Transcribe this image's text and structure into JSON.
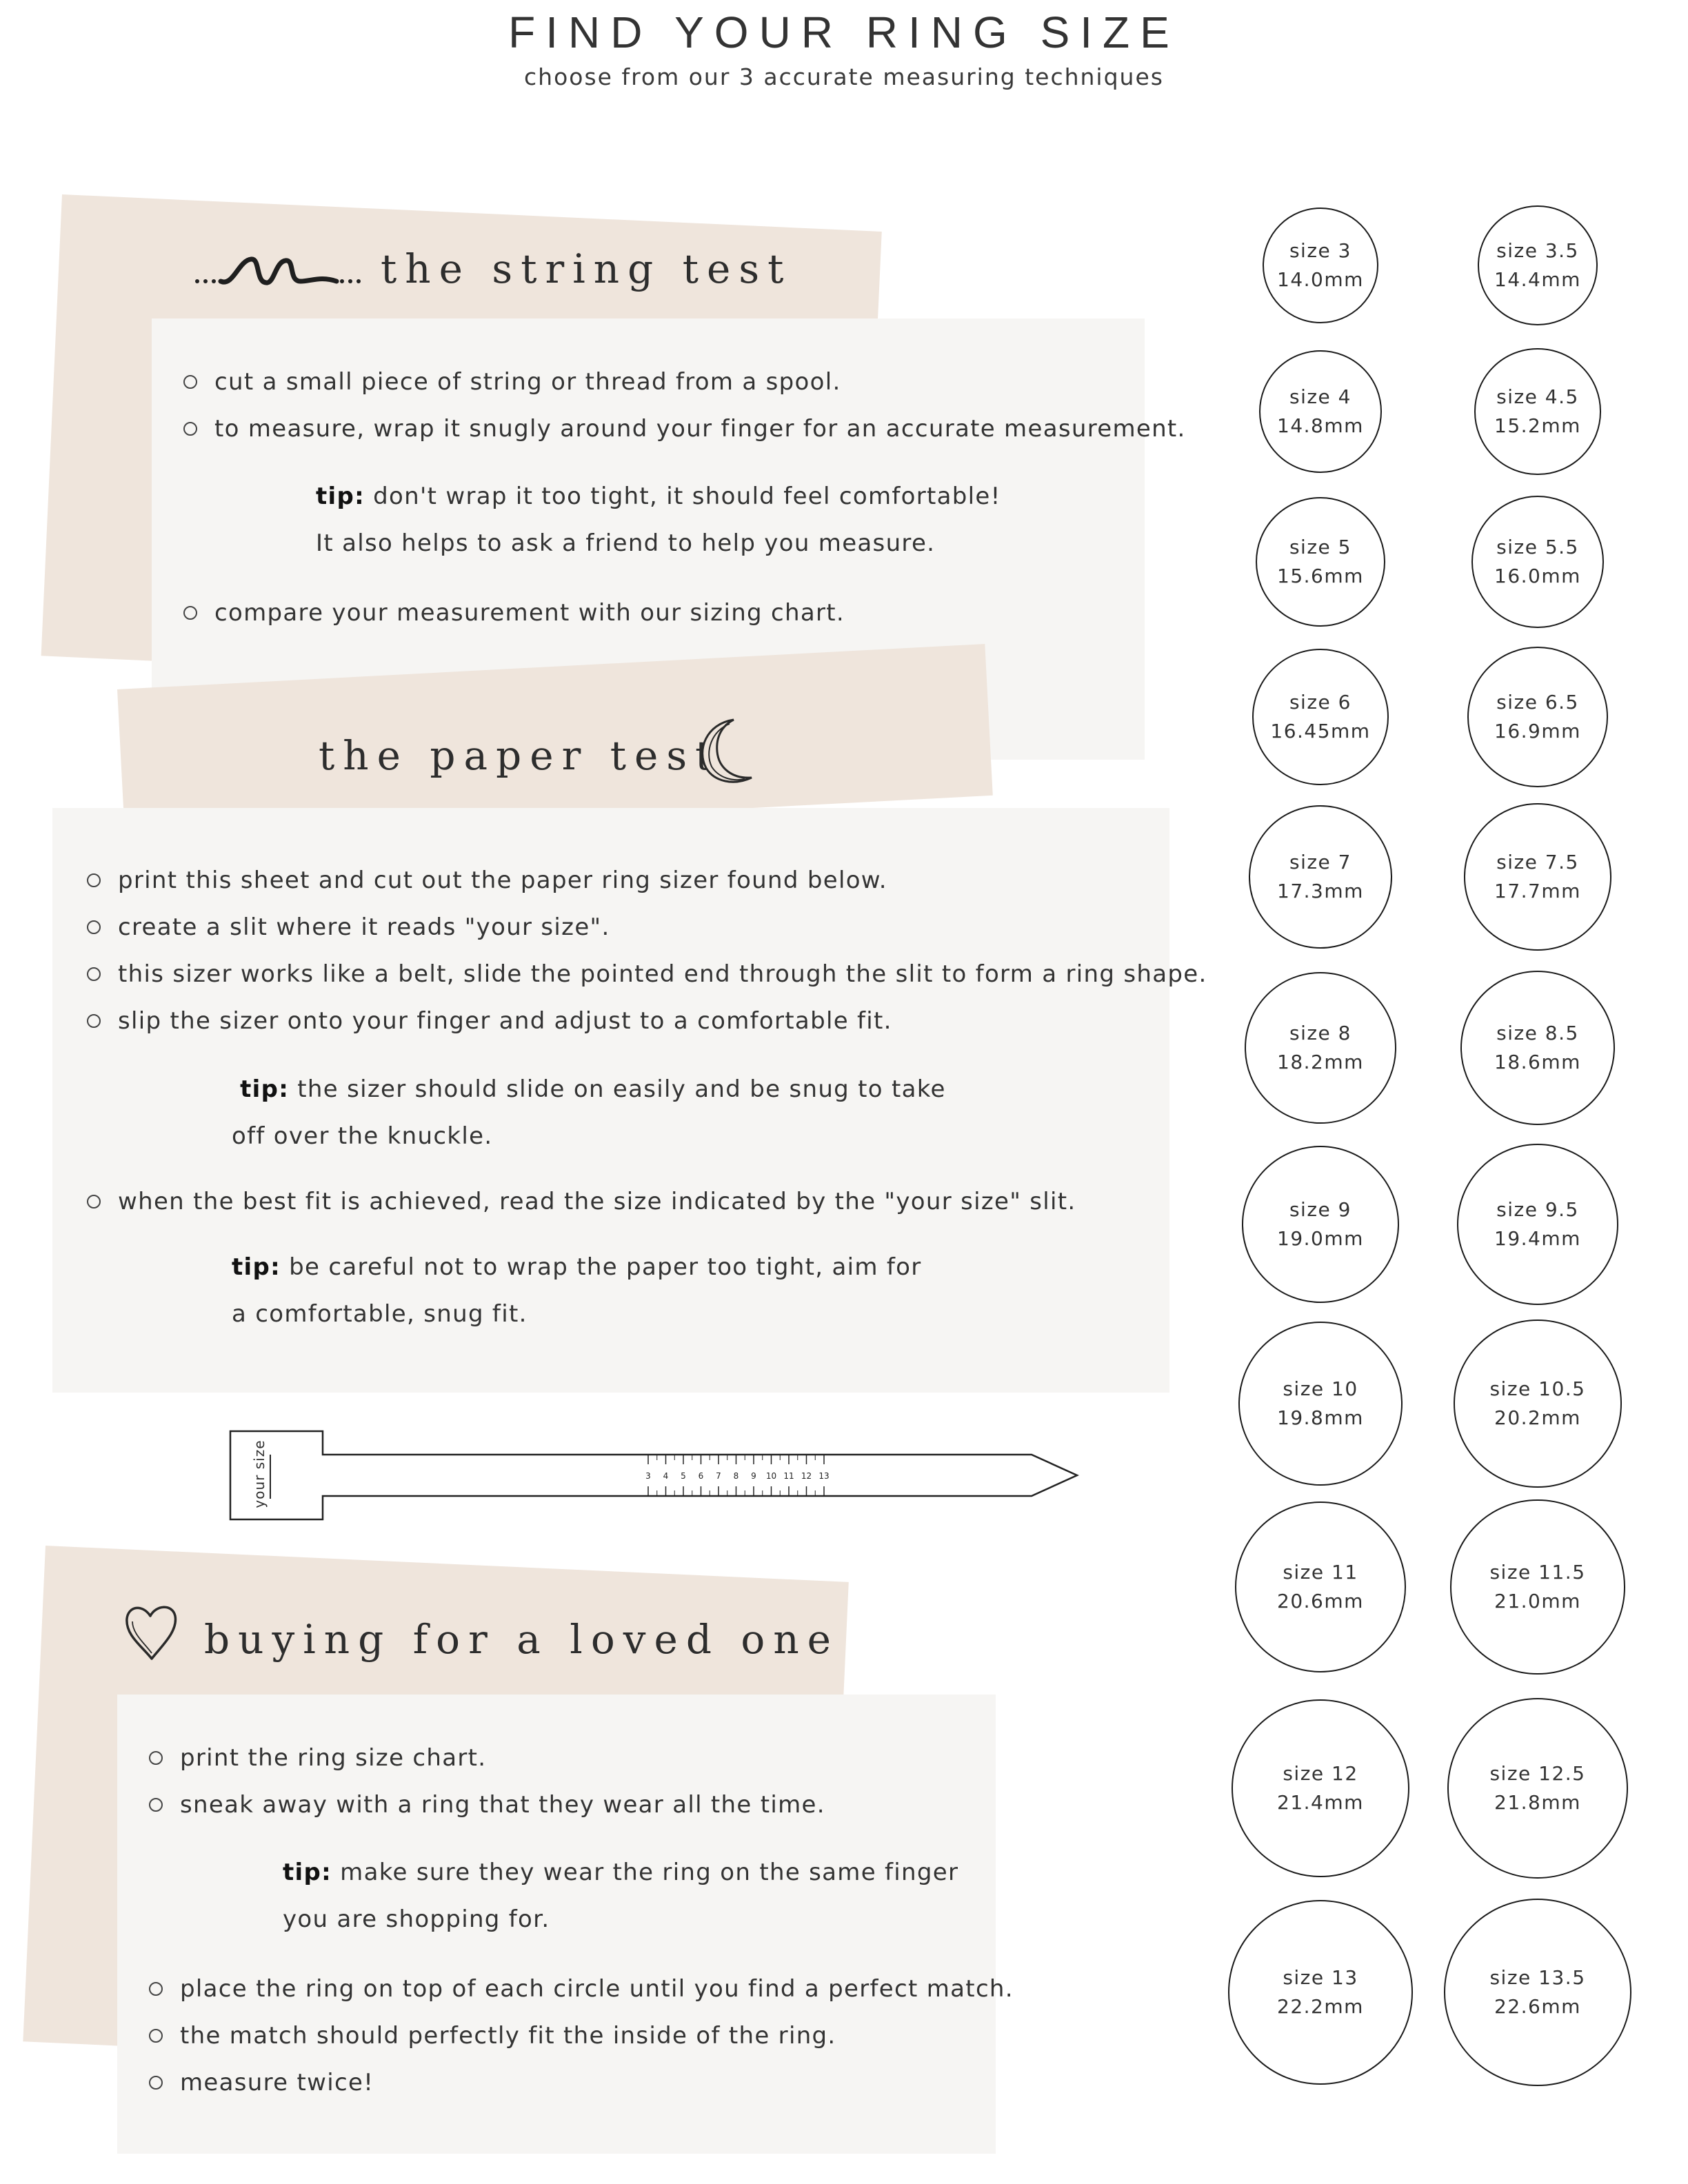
{
  "header": {
    "title": "FIND YOUR RING SIZE",
    "subtitle": "choose from our 3 accurate measuring techniques"
  },
  "string_test": {
    "title": "the string test",
    "icon": "wave-icon",
    "bullets_a": [
      "cut a small piece of string or thread from a spool.",
      "to measure, wrap it snugly around your finger for an accurate measurement."
    ],
    "tip_label": "tip:",
    "tip_line1": "don't wrap it too tight, it should feel comfortable!",
    "tip_line2": "It also helps to ask a friend to help you measure.",
    "bullets_b": [
      "compare your measurement with our sizing chart."
    ]
  },
  "paper_test": {
    "title": "the paper test",
    "icon": "moon-icon",
    "bullets_a": [
      "print this sheet and cut out the paper ring sizer found below.",
      "create a slit where it reads \"your size\".",
      "this sizer works like a belt, slide the pointed end through the slit to form a ring shape.",
      "slip the sizer onto your finger and adjust to a comfortable fit."
    ],
    "tip1_label": "tip:",
    "tip1_line1": "the sizer should slide on easily and be snug to take",
    "tip1_line2": "off over the knuckle.",
    "bullets_b": [
      "when the best fit is achieved, read the size indicated by the \"your size\" slit."
    ],
    "tip2_label": "tip:",
    "tip2_line1": "be careful not to wrap the paper too tight, aim for",
    "tip2_line2": "a comfortable, snug fit."
  },
  "sizer": {
    "label": "your size",
    "ticks": [
      "3",
      "4",
      "5",
      "6",
      "7",
      "8",
      "9",
      "10",
      "11",
      "12",
      "13"
    ]
  },
  "loved_one": {
    "title": "buying for a loved one",
    "icon": "heart-icon",
    "bullets_a": [
      "print the ring size chart.",
      "sneak away with a ring that they wear all the time."
    ],
    "tip_label": "tip:",
    "tip_line1": "make sure they wear the ring on the same finger",
    "tip_line2": "you are shopping for.",
    "bullets_b": [
      "place the ring on top of each circle until you find a perfect match.",
      "the match should perfectly fit the inside of the ring.",
      "measure twice!"
    ]
  },
  "ring_sizes": [
    {
      "size": "size 3",
      "mm": "14.0mm",
      "diameter_mm": 14.0
    },
    {
      "size": "size 3.5",
      "mm": "14.4mm",
      "diameter_mm": 14.4
    },
    {
      "size": "size 4",
      "mm": "14.8mm",
      "diameter_mm": 14.8
    },
    {
      "size": "size 4.5",
      "mm": "15.2mm",
      "diameter_mm": 15.2
    },
    {
      "size": "size 5",
      "mm": "15.6mm",
      "diameter_mm": 15.6
    },
    {
      "size": "size 5.5",
      "mm": "16.0mm",
      "diameter_mm": 16.0
    },
    {
      "size": "size 6",
      "mm": "16.45mm",
      "diameter_mm": 16.45
    },
    {
      "size": "size 6.5",
      "mm": "16.9mm",
      "diameter_mm": 16.9
    },
    {
      "size": "size 7",
      "mm": "17.3mm",
      "diameter_mm": 17.3
    },
    {
      "size": "size 7.5",
      "mm": "17.7mm",
      "diameter_mm": 17.7
    },
    {
      "size": "size 8",
      "mm": "18.2mm",
      "diameter_mm": 18.2
    },
    {
      "size": "size 8.5",
      "mm": "18.6mm",
      "diameter_mm": 18.6
    },
    {
      "size": "size 9",
      "mm": "19.0mm",
      "diameter_mm": 19.0
    },
    {
      "size": "size 9.5",
      "mm": "19.4mm",
      "diameter_mm": 19.4
    },
    {
      "size": "size 10",
      "mm": "19.8mm",
      "diameter_mm": 19.8
    },
    {
      "size": "size 10.5",
      "mm": "20.2mm",
      "diameter_mm": 20.2
    },
    {
      "size": "size 11",
      "mm": "20.6mm",
      "diameter_mm": 20.6
    },
    {
      "size": "size 11.5",
      "mm": "21.0mm",
      "diameter_mm": 21.0
    },
    {
      "size": "size 12",
      "mm": "21.4mm",
      "diameter_mm": 21.4
    },
    {
      "size": "size 12.5",
      "mm": "21.8mm",
      "diameter_mm": 21.8
    },
    {
      "size": "size 13",
      "mm": "22.2mm",
      "diameter_mm": 22.2
    },
    {
      "size": "size 13.5",
      "mm": "22.6mm",
      "diameter_mm": 22.6
    }
  ]
}
